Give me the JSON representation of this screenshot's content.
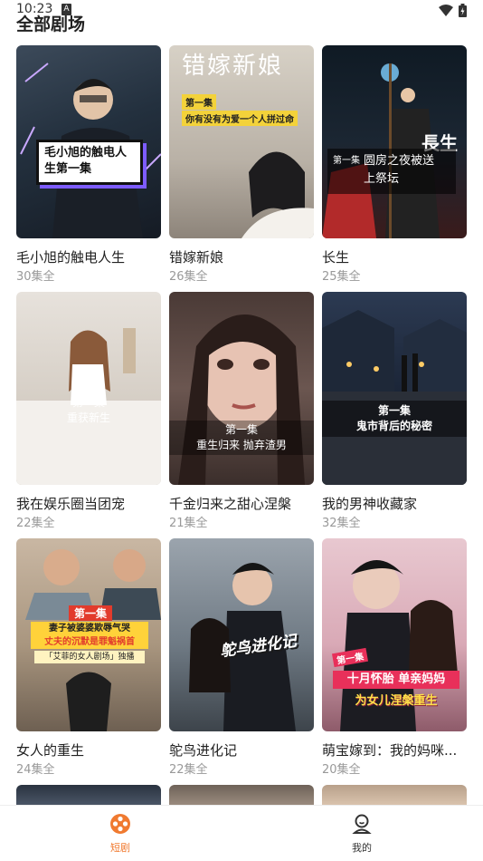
{
  "status_bar": {
    "time": "10:23",
    "notif_letter": "A",
    "icons": [
      "wifi-icon",
      "battery-icon"
    ]
  },
  "page": {
    "title": "全部剧场"
  },
  "cards": [
    {
      "title": "毛小旭的触电人生",
      "count": "30集全",
      "overlay": "毛小旭的触电人生第一集"
    },
    {
      "title": "错嫁新娘",
      "count": "26集全",
      "overlay_brand": "错嫁新娘",
      "overlay_episode": "第一集",
      "overlay": "你有没有为爱一个人拼过命"
    },
    {
      "title": "长生",
      "count": "25集全",
      "overlay_brand": "長生",
      "overlay_episode": "第一集",
      "overlay": "圆房之夜被送上祭坛"
    },
    {
      "title": "我在娱乐圈当团宠",
      "count": "22集全",
      "overlay_episode": "第一集",
      "overlay": "重获新生"
    },
    {
      "title": "千金归来之甜心涅槃",
      "count": "21集全",
      "overlay_episode": "第一集",
      "overlay": "重生归来 抛弃渣男"
    },
    {
      "title": "我的男神收藏家",
      "count": "32集全",
      "overlay_episode": "第一集",
      "overlay": "鬼市背后的秘密"
    },
    {
      "title": "女人的重生",
      "count": "24集全",
      "overlay_episode": "第一集",
      "overlay": "妻子被婆婆欺辱气哭",
      "overlay2": "丈夫的沉默是罪魁祸首",
      "overlay3": "「艾菲的女人剧场」独播"
    },
    {
      "title": "鸵鸟进化记",
      "count": "22集全",
      "overlay": "鸵鸟进化记"
    },
    {
      "title": "萌宝嫁到：我的妈咪...",
      "count": "20集全",
      "overlay_episode": "第一集",
      "overlay": "十月怀胎 单亲妈妈",
      "overlay2": "为女儿涅槃重生"
    }
  ],
  "nav": {
    "items": [
      {
        "label": "短剧",
        "icon": "film-reel-icon",
        "active": true
      },
      {
        "label": "我的",
        "icon": "user-icon",
        "active": false
      }
    ],
    "active_color": "#F07A30",
    "inactive_color": "#333333"
  }
}
